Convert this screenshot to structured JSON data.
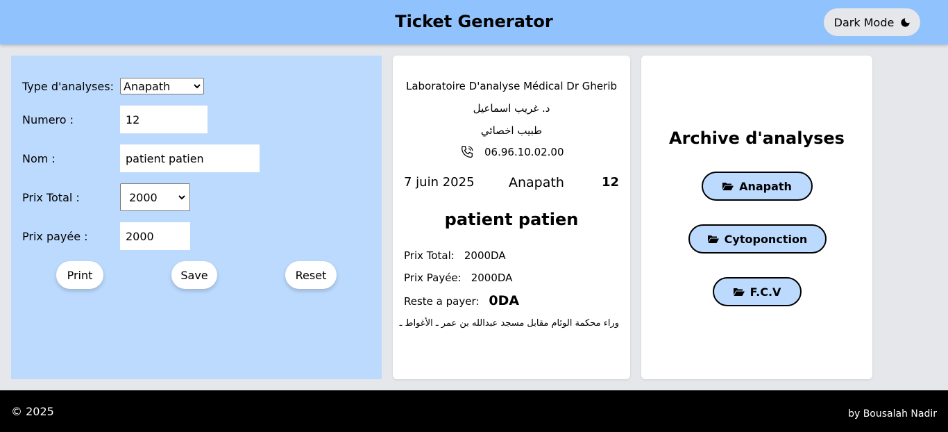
{
  "header": {
    "title": "Ticket Generator",
    "dark_mode_label": "Dark Mode",
    "icon": "moon-icon"
  },
  "form": {
    "type_label": "Type d'analyses:",
    "type_value": "Anapath",
    "numero_label": "Numero :",
    "numero_value": "12",
    "nom_label": "Nom :",
    "nom_value": "patient patien",
    "prix_total_label": "Prix Total :",
    "prix_total_value": "2000",
    "prix_payee_label": "Prix payée :",
    "prix_payee_value": "2000",
    "buttons": {
      "print": "Print",
      "save": "Save",
      "reset": "Reset"
    }
  },
  "ticket": {
    "lab_name": "Laboratoire D'analyse Médical Dr Gherib",
    "doctor_ar": "د. غريب اسماعيل",
    "specialty_ar": "طبيب اخصائي",
    "phone": "06.96.10.02.00",
    "date": "7 juin 2025",
    "type": "Anapath",
    "number": "12",
    "patient_name": "patient patien",
    "prix_total_label": "Prix Total:",
    "prix_total_value": "2000DA",
    "prix_payee_label": "Prix Payée:",
    "prix_payee_value": "2000DA",
    "reste_label": "Reste a payer:",
    "reste_value": "0DA",
    "address_ar": "وراء محكمة الوئام مقابل مسجد عبدالله بن عمر ـ الأغواط ـ"
  },
  "archive": {
    "title": "Archive d'analyses",
    "items": [
      {
        "label": "Anapath"
      },
      {
        "label": "Cytoponction"
      },
      {
        "label": "F.C.V"
      }
    ],
    "icon": "folder-open-icon"
  },
  "footer": {
    "copyright": "© 2025",
    "author": "by Bousalah Nadir"
  },
  "colors": {
    "header_bg": "#90c2fd",
    "form_bg": "#bcdafe",
    "page_bg": "#e5e7eb",
    "footer_bg": "#000000"
  }
}
